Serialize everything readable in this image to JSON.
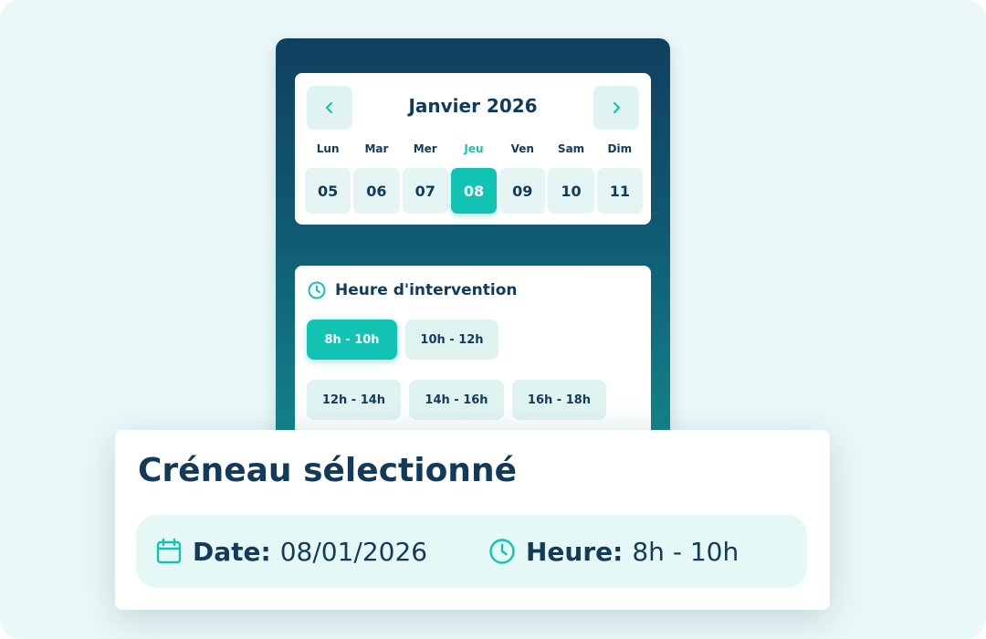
{
  "colors": {
    "accent": "#12c2b2",
    "navy": "#123a5a",
    "panel_top": "#11405f",
    "panel_bottom": "#138a8e",
    "light_teal": "#dff4f2",
    "background": "#eaf8f8"
  },
  "calendar": {
    "month_title": "Janvier 2026",
    "prev_icon": "chevron-left-icon",
    "next_icon": "chevron-right-icon",
    "weekdays": [
      "Lun",
      "Mar",
      "Mer",
      "Jeu",
      "Ven",
      "Sam",
      "Dim"
    ],
    "days": [
      "05",
      "06",
      "07",
      "08",
      "09",
      "10",
      "11"
    ],
    "selected_day": "08",
    "active_weekday": "Jeu"
  },
  "time": {
    "title": "Heure d'intervention",
    "icon": "clock-icon",
    "slots": [
      "8h - 10h",
      "10h - 12h",
      "12h - 14h",
      "14h - 16h",
      "16h - 18h"
    ],
    "selected_slot": "8h - 10h"
  },
  "summary": {
    "title": "Créneau sélectionné",
    "date_label": "Date:",
    "date_value": "08/01/2026",
    "date_icon": "calendar-icon",
    "time_label": "Heure:",
    "time_value": "8h - 10h",
    "time_icon": "clock-icon"
  }
}
